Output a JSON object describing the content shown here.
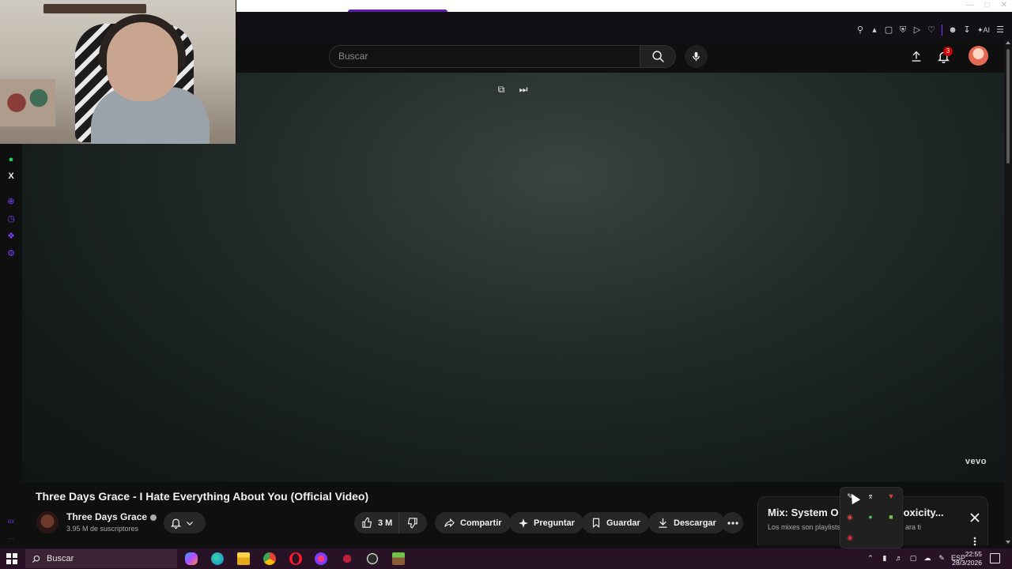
{
  "masthead": {
    "search_placeholder": "Buscar",
    "notification_count": "3"
  },
  "player": {
    "watermark": "vevo"
  },
  "video": {
    "title": "Three Days Grace - I Hate Everything About You (Official Video)",
    "channel_name": "Three Days Grace",
    "subscribers": "3.95 M de suscriptores",
    "likes": "3 M",
    "actions": {
      "share": "Compartir",
      "ask": "Preguntar",
      "save": "Guardar",
      "download": "Descargar"
    }
  },
  "mix": {
    "title": "Mix: System O",
    "title_end": "oxicity...",
    "subtitle": "Los mixes son playlists",
    "subtitle_end": "ara ti"
  },
  "taskbar": {
    "search_label": "Buscar",
    "language": "ESP",
    "time": "22:55",
    "date": "28/3/2026"
  },
  "colors": {
    "background": "#0f0f0f",
    "opera_accent": "#7d3cff",
    "notification_badge": "#cc0000",
    "taskbar": "#281225"
  },
  "icons": {
    "whatsapp": "whatsapp-icon",
    "x": "x-icon",
    "search": "search-icon",
    "mic": "mic-icon",
    "upload": "upload-icon",
    "bell": "bell-icon",
    "like": "thumbs-up-icon",
    "dislike": "thumbs-down-icon"
  }
}
